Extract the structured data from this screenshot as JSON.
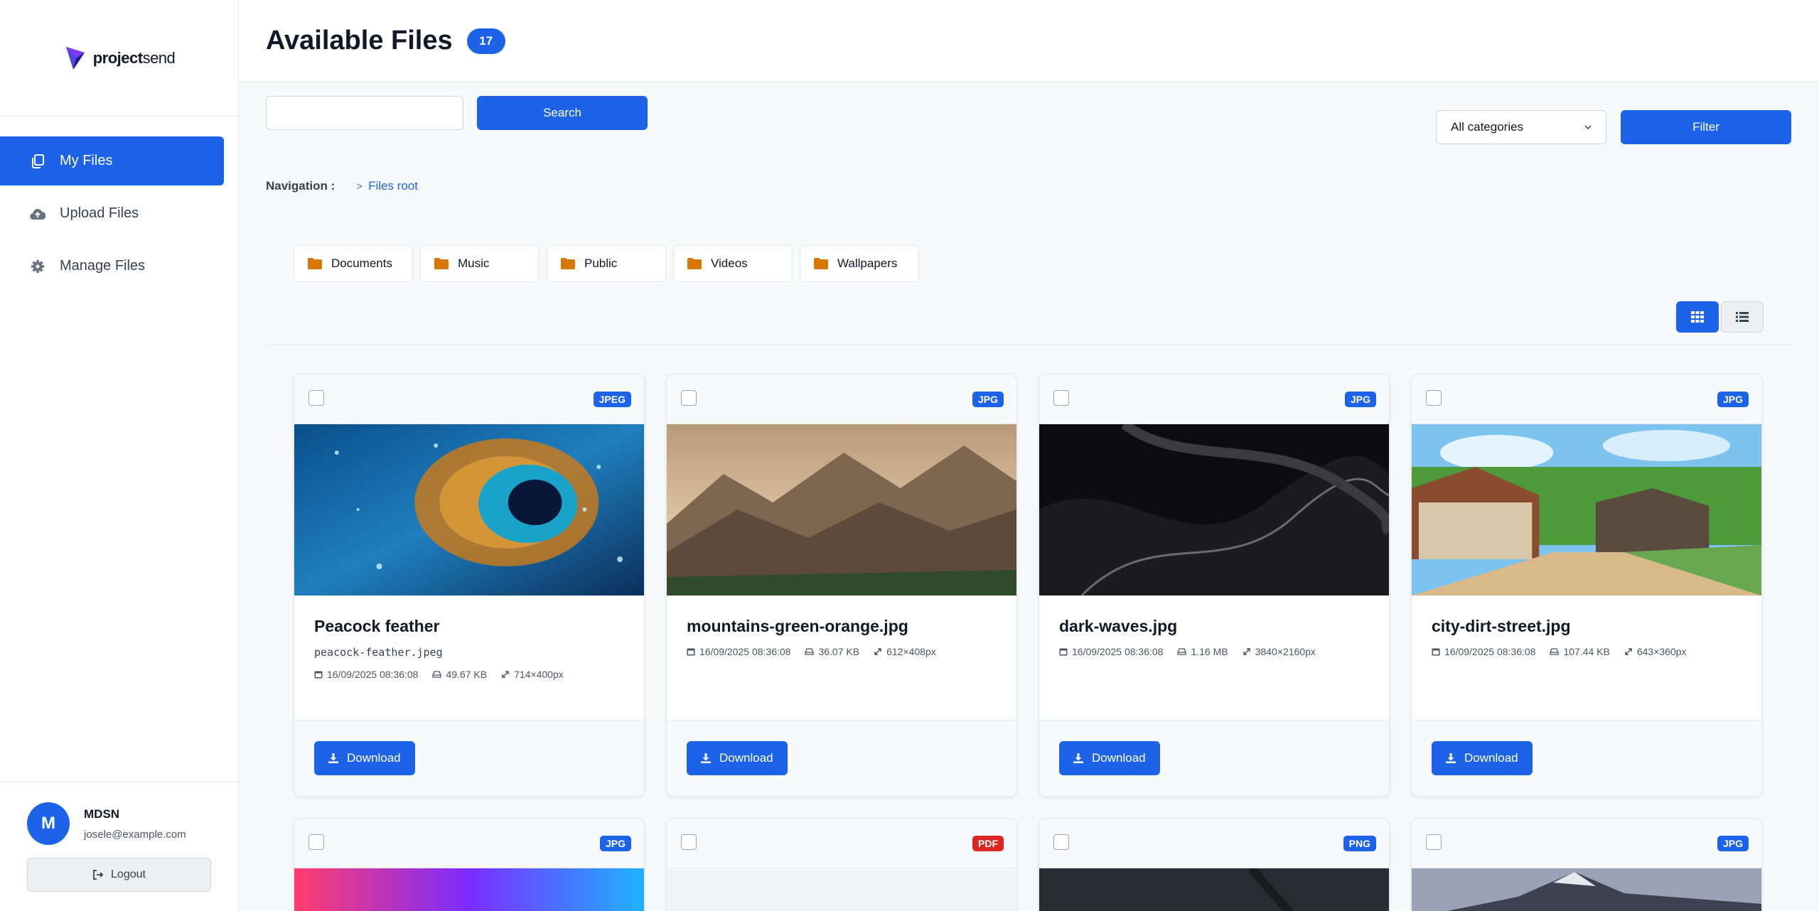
{
  "brand": {
    "name_bold": "project",
    "name_rest": "send"
  },
  "sidebar": {
    "items": [
      {
        "label": "My Files",
        "icon": "files-icon",
        "active": true
      },
      {
        "label": "Upload Files",
        "icon": "cloud-upload-icon",
        "active": false
      },
      {
        "label": "Manage Files",
        "icon": "gear-icon",
        "active": false
      }
    ]
  },
  "user": {
    "initial": "M",
    "name": "MDSN",
    "email": "josele@example.com",
    "logout_label": "Logout"
  },
  "header": {
    "title": "Available Files",
    "count": "17"
  },
  "search": {
    "value": "",
    "button_label": "Search"
  },
  "filter": {
    "category_selected": "All categories",
    "button_label": "Filter"
  },
  "breadcrumb": {
    "label": "Navigation :",
    "separator": ">",
    "root": "Files root"
  },
  "folders": [
    "Documents",
    "Music",
    "Public",
    "Videos",
    "Wallpapers"
  ],
  "files": [
    {
      "ext": "JPEG",
      "title": "Peacock feather",
      "original": "peacock-feather.jpeg",
      "date": "16/09/2025 08:36:08",
      "size": "49.67 KB",
      "dims": "714×400px",
      "download_label": "Download"
    },
    {
      "ext": "JPG",
      "title": "mountains-green-orange.jpg",
      "original": "",
      "date": "16/09/2025 08:36:08",
      "size": "36.07 KB",
      "dims": "612×408px",
      "download_label": "Download"
    },
    {
      "ext": "JPG",
      "title": "dark-waves.jpg",
      "original": "",
      "date": "16/09/2025 08:36:08",
      "size": "1.16 MB",
      "dims": "3840×2160px",
      "download_label": "Download"
    },
    {
      "ext": "JPG",
      "title": "city-dirt-street.jpg",
      "original": "",
      "date": "16/09/2025 08:36:08",
      "size": "107.44 KB",
      "dims": "643×360px",
      "download_label": "Download"
    }
  ],
  "files_row2": [
    {
      "ext": "JPG"
    },
    {
      "ext": "PDF"
    },
    {
      "ext": "PNG"
    },
    {
      "ext": "JPG"
    }
  ],
  "colors": {
    "accent": "#1d63e8",
    "folder": "#d97706",
    "pdf": "#dc2626"
  }
}
